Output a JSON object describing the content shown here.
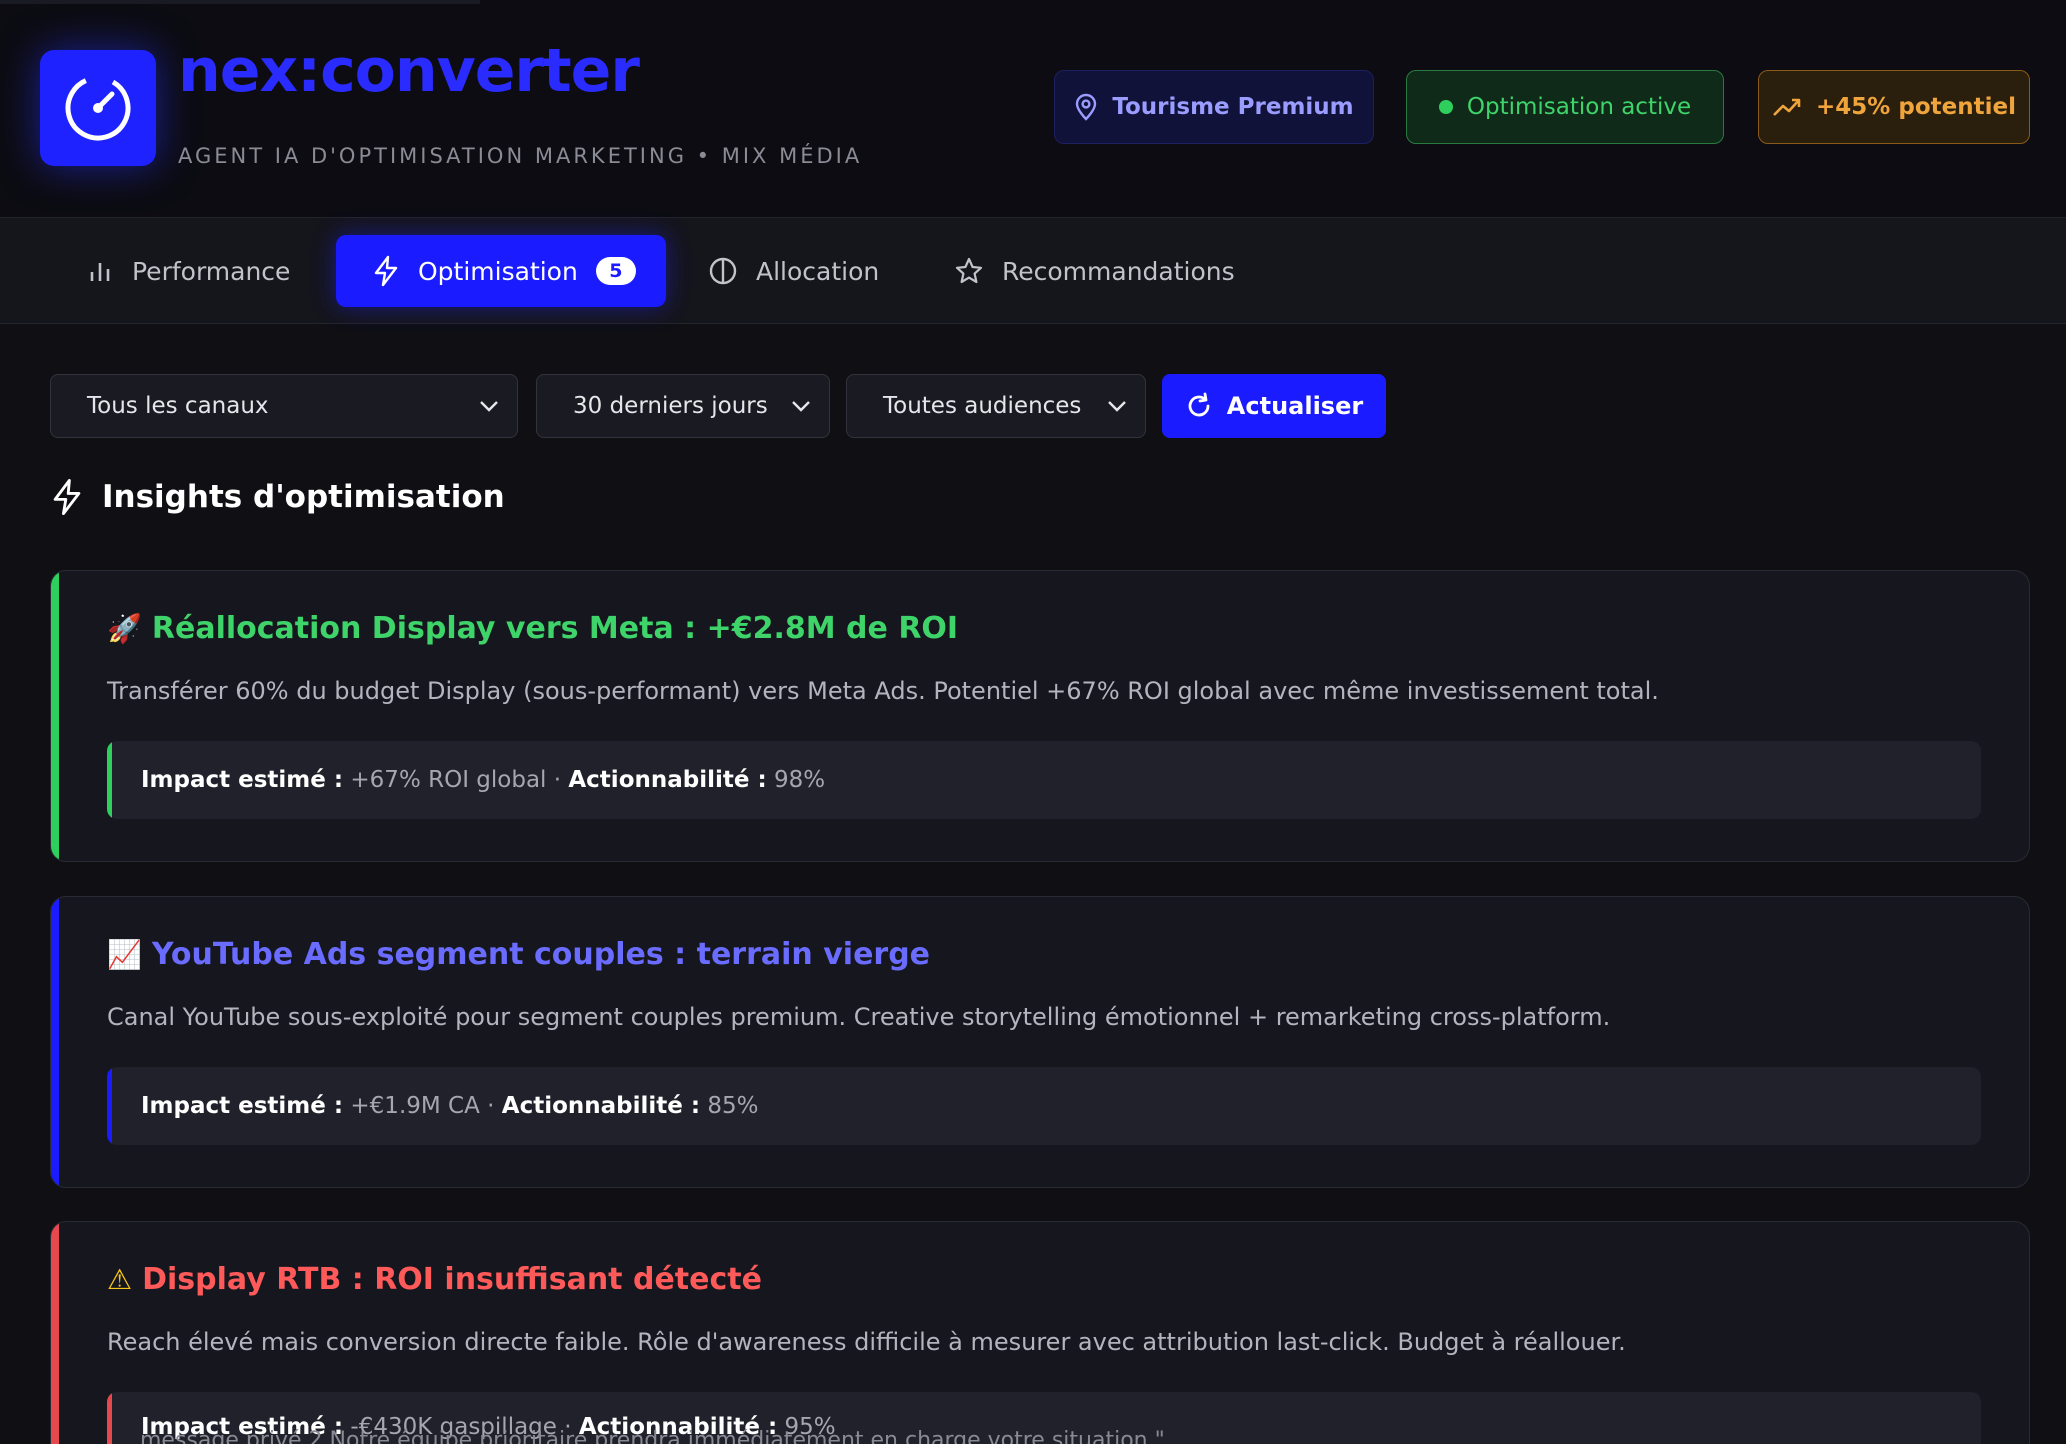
{
  "header": {
    "brand": "nex:converter",
    "tagline": "AGENT IA D'OPTIMISATION MARKETING • MIX MÉDIA",
    "pill_tourism": "Tourisme Premium",
    "pill_optimization": "Optimisation active",
    "pill_potential": "+45% potentiel"
  },
  "tabs": [
    {
      "label": "Performance"
    },
    {
      "label": "Optimisation",
      "badge": "5"
    },
    {
      "label": "Allocation"
    },
    {
      "label": "Recommandations"
    }
  ],
  "filters": {
    "channels": "Tous les canaux",
    "period": "30 derniers jours",
    "audience": "Toutes audiences",
    "refresh": "Actualiser"
  },
  "section": {
    "title": "Insights d'optimisation"
  },
  "insights": [
    {
      "emoji": "🚀",
      "title": "Réallocation Display vers Meta : +€2.8M de ROI",
      "description": "Transférer 60% du budget Display (sous-performant) vers Meta Ads. Potentiel +67% ROI global avec même investissement total.",
      "impact_label": "Impact estimé :",
      "impact_value": "+67% ROI global",
      "separator": "·",
      "action_label": "Actionnabilité :",
      "action_value": "98%"
    },
    {
      "emoji": "📈",
      "title": "YouTube Ads segment couples : terrain vierge",
      "description": "Canal YouTube sous-exploité pour segment couples premium. Creative storytelling émotionnel + remarketing cross-platform.",
      "impact_label": "Impact estimé :",
      "impact_value": "+€1.9M CA",
      "separator": "·",
      "action_label": "Actionnabilité :",
      "action_value": "85%"
    },
    {
      "emoji": "⚠",
      "title": "Display RTB : ROI insuffisant détecté",
      "description": "Reach élevé mais conversion directe faible. Rôle d'awareness difficile à mesurer avec attribution last-click. Budget à réallouer.",
      "impact_label": "Impact estimé :",
      "impact_value": "-€430K gaspillage",
      "separator": "·",
      "action_label": "Actionnabilité :",
      "action_value": "95%"
    }
  ],
  "overlay": {
    "text": "message privé 2 Notre équipe prioritaire prendra immédiatement en charge votre situation.\""
  },
  "colors": {
    "accent": "#1a1cff",
    "success": "#3fd46a",
    "info": "#6a6cff",
    "danger": "#ff5a5a",
    "warning": "#f0a43c"
  }
}
